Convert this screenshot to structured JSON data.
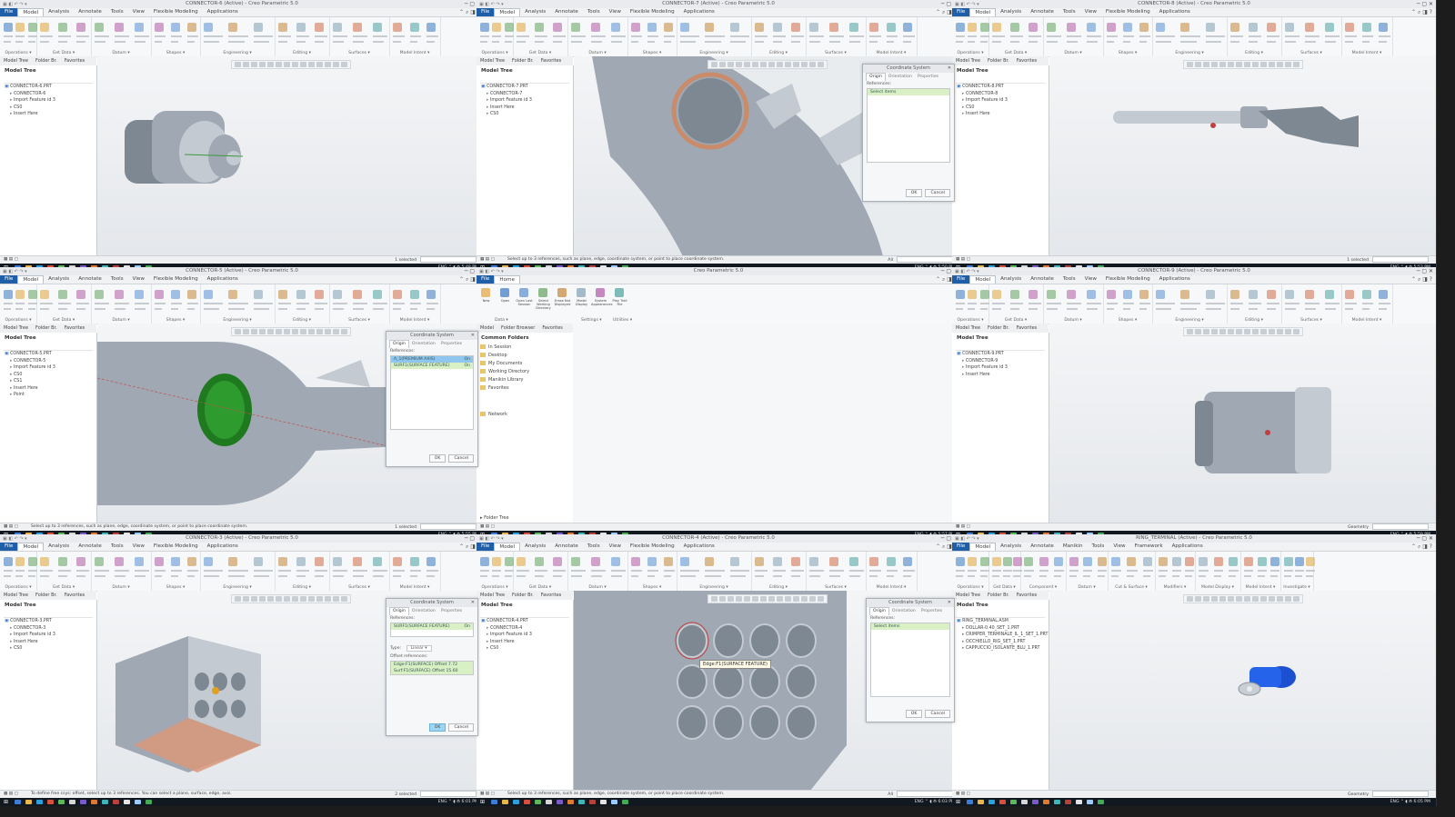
{
  "common": {
    "file_tab": "File",
    "model_tabs": [
      "Model",
      "Analysis",
      "Annotate",
      "Tools",
      "View",
      "Flexible Modeling",
      "Applications"
    ],
    "ribbon_groups": [
      "Operations",
      "Get Data",
      "Datum",
      "Shapes",
      "Engineering",
      "Editing",
      "Surfaces",
      "Model Intent"
    ],
    "left_tabs": [
      "Model Tree",
      "Folder Br.",
      "Favorites"
    ],
    "model_tree_title": "Model Tree",
    "filter_value": "Geometry",
    "dialog_title": "Coordinate System",
    "dialog_tabs": [
      "Origin",
      "Orientation",
      "Properties"
    ],
    "dialog_ref_label": "References:",
    "dialog_select": "Select items",
    "ok": "OK",
    "cancel": "Cancel",
    "windows_icon": "windows-icon",
    "accent": "#1f5fa8",
    "selection_green": "#d9f0c4"
  },
  "panels": [
    {
      "title": "CONNECTOR-6 (Active) - Creo Parametric 5.0",
      "tree": [
        "CONNECTOR-6.PRT",
        "CONNECTOR-6",
        "Import Feature id 3",
        "CS0",
        "Insert Here"
      ],
      "status_left": "",
      "status_right": "1 selected",
      "time": "5:48 PM"
    },
    {
      "title": "CONNECTOR-7 (Active) - Creo Parametric 5.0",
      "tree": [
        "CONNECTOR-7.PRT",
        "CONNECTOR-7",
        "Import Feature id 3",
        "Insert Here",
        "CS0"
      ],
      "status_left": "Select up to 3 references, such as plane, edge, coordinate system, or point to place coordinate system.",
      "status_right": "All",
      "time": "5:50 PM"
    },
    {
      "title": "CONNECTOR-8 (Active) - Creo Parametric 5.0",
      "tree": [
        "CONNECTOR-8.PRT",
        "CONNECTOR-8",
        "Import Feature id 3",
        "CS0",
        "Insert Here"
      ],
      "status_left": "",
      "status_right": "1 selected",
      "time": "5:53 PM"
    },
    {
      "title": "CONNECTOR-5 (Active) - Creo Parametric 5.0",
      "tree": [
        "CONNECTOR-5.PRT",
        "CONNECTOR-5",
        "Import Feature id 3",
        "CS0",
        "CS1",
        "Insert Here",
        "Point"
      ],
      "status_left": "Select up to 3 references, such as plane, edge, coordinate system, or point to place coordinate system.",
      "status_right": "1 selected",
      "time": "5:55 PM",
      "dialog_rows": [
        "A_1(PREMIUM AXIS)",
        "SURF1(SURFACE FEATURE)"
      ],
      "dialog_row_values": [
        "On",
        "On"
      ]
    },
    {
      "title": "Creo Parametric 5.0",
      "home_tab": "Home",
      "home_tools": [
        "New",
        "Open",
        "Open Last Session",
        "Select Working Directory",
        "Erase Not Displayed",
        "Model Display",
        "System Appearances",
        "Play Trail File"
      ],
      "home_groups": [
        "Data",
        "Settings",
        "Utilities"
      ],
      "browser_tabs": [
        "Model",
        "Folder Browser",
        "Favorites"
      ],
      "common_folders": "Common Folders",
      "folders": [
        "In Session",
        "Desktop",
        "My Documents",
        "Working Directory",
        "Manikin Library",
        "Favorites",
        "Network"
      ],
      "folder_tree": "Folder Tree",
      "time": "5:57 PM"
    },
    {
      "title": "CONNECTOR-9 (Active) - Creo Parametric 5.0",
      "tree": [
        "CONNECTOR-9.PRT",
        "CONNECTOR-9",
        "Import Feature id 3",
        "Insert Here"
      ],
      "status_left": "",
      "status_right": "Geometry",
      "time": "5:59 PM"
    },
    {
      "title": "CONNECTOR-3 (Active) - Creo Parametric 5.0",
      "tree": [
        "CONNECTOR-3.PRT",
        "CONNECTOR-3",
        "Import Feature id 3",
        "Insert Here",
        "CS0"
      ],
      "status_left": "To define free csys: offset, select up to 3 references. You can select a plane, surface, edge, axis.",
      "status_right": "2 selected",
      "time": "6:01 PM",
      "dialog_rows": [
        "SURF1(SURFACE FEATURE)"
      ],
      "dialog_row_values": [
        "On"
      ],
      "type_label": "Type:",
      "type_value": "Linear",
      "offset_label": "Offset references:",
      "offset_rows": [
        "Edge:F1(SURFACE) Offset 7.72",
        "Surf:F1(SURFACE) Offset 15.60"
      ]
    },
    {
      "title": "CONNECTOR-4 (Active) - Creo Parametric 5.0",
      "tree": [
        "CONNECTOR-4.PRT",
        "CONNECTOR-4",
        "Import Feature id 3",
        "Insert Here",
        "CS0"
      ],
      "status_left": "Select up to 3 references, such as plane, edge, coordinate system, or point to place coordinate system.",
      "status_right": "All",
      "time": "6:03 PM",
      "tooltip": "Edge:F1(SURFACE FEATURE)"
    },
    {
      "title": "RING_TERMINAL (Active) - Creo Parametric 5.0",
      "tabs": [
        "Model",
        "Analysis",
        "Annotate",
        "Manikin",
        "Tools",
        "View",
        "Framework",
        "Applications"
      ],
      "ribbon_groups": [
        "Operations",
        "Get Data",
        "Component",
        "Datum",
        "Cut & Surface",
        "Modifiers",
        "Model Display",
        "Model Intent",
        "Investigate"
      ],
      "tree": [
        "RING_TERMINAL.ASM",
        "DOLLAR-0.40_SET_1.PRT",
        "CRIMPER_TERMINALE_IL_1_SET_1.PRT",
        "OCCHIELLO_RIG_SET_1.PRT",
        "CAPPUCCIO_ISOLANTE_BLU_1.PRT"
      ],
      "status_right": "Geometry",
      "time": "6:05 PM"
    }
  ]
}
